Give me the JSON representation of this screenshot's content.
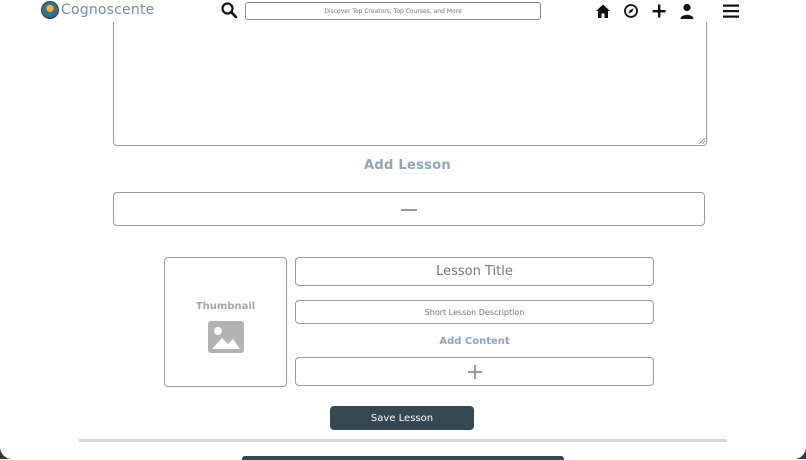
{
  "brand": {
    "name": "Cognoscente"
  },
  "header": {
    "search_placeholder": "Discover Top Creators, Top Courses, and More",
    "icons": [
      "search-icon",
      "home-icon",
      "compass-icon",
      "plus-icon",
      "user-icon",
      "menu-icon"
    ]
  },
  "lessons": {
    "add_lesson_label": "Add Lesson",
    "collapse_icon": "minus-icon"
  },
  "lesson_editor": {
    "thumbnail_label": "Thumbnail",
    "thumbnail_icon": "image-icon",
    "title_placeholder": "Lesson Title",
    "description_placeholder": "Short Lesson Description",
    "add_content_label": "Add Content",
    "add_content_icon": "plus-icon",
    "save_label": "Save Lesson"
  },
  "colors": {
    "accent_label": "#8fa5bd",
    "brand_text": "#6f8fa8",
    "primary_button": "#334852",
    "border": "#9a9a9a"
  }
}
